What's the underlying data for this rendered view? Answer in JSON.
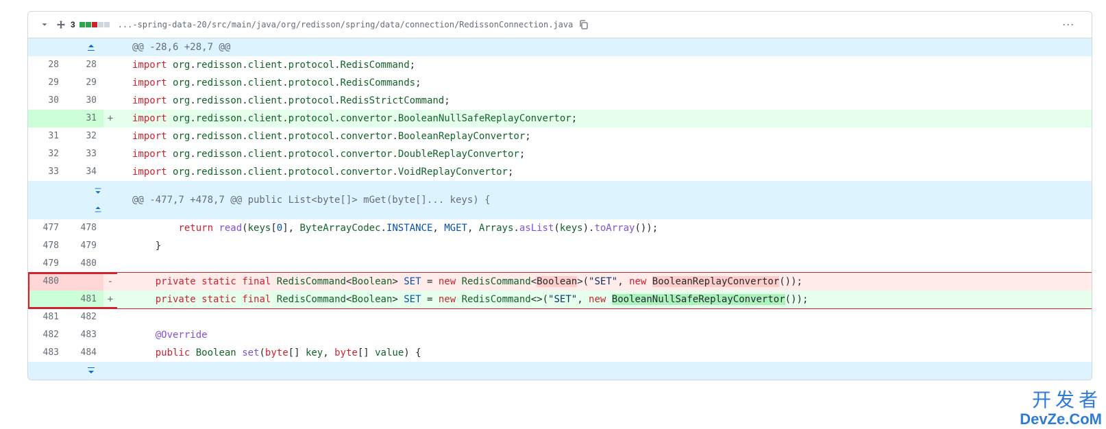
{
  "header": {
    "changes": "3",
    "path": "...-spring-data-20/src/main/java/org/redisson/spring/data/connection/RedissonConnection.java"
  },
  "hunks": {
    "h1": "@@ -28,6 +28,7 @@",
    "h2": "@@ -477,7 +478,7 @@ public List<byte[]> mGet(byte[]... keys) {"
  },
  "lines": {
    "l28o": "28",
    "l28n": "28",
    "c28": "import org.redisson.client.protocol.RedisCommand;",
    "l29o": "29",
    "l29n": "29",
    "c29": "import org.redisson.client.protocol.RedisCommands;",
    "l30o": "30",
    "l30n": "30",
    "c30": "import org.redisson.client.protocol.RedisStrictCommand;",
    "l31n": "31",
    "c31": "import org.redisson.client.protocol.convertor.BooleanNullSafeReplayConvertor;",
    "l31o": "31",
    "l32n": "32",
    "c32": "import org.redisson.client.protocol.convertor.BooleanReplayConvertor;",
    "l32o": "32",
    "l33n": "33",
    "c33": "import org.redisson.client.protocol.convertor.DoubleReplayConvertor;",
    "l33o": "33",
    "l34n": "34",
    "c34": "import org.redisson.client.protocol.convertor.VoidReplayConvertor;",
    "l477o": "477",
    "l478n": "478",
    "l478o": "478",
    "l479n": "479",
    "c478": "    }",
    "l479o": "479",
    "l480n": "480",
    "c479": "",
    "l480o": "480",
    "l481n": "481",
    "l481o": "481",
    "l482n": "482",
    "c481": "",
    "l482o": "482",
    "l483n": "483",
    "c482": "    @Override",
    "l483o": "483",
    "l484n": "484"
  },
  "watermark": {
    "line1": "开发者",
    "line2": "DevZe.CoM"
  }
}
